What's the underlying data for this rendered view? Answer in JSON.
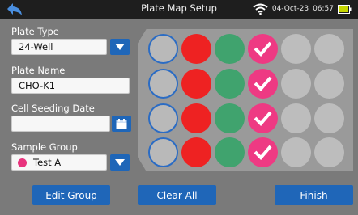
{
  "header": {
    "title": "Plate Map Setup",
    "date": "04-Oct-23",
    "time": "06:57",
    "icons": [
      "back-arrow-icon",
      "wifi-icon",
      "battery-icon"
    ]
  },
  "form": {
    "plate_type": {
      "label": "Plate Type",
      "value": "24-Well"
    },
    "plate_name": {
      "label": "Plate Name",
      "value": "CHO-K1"
    },
    "seeding_date": {
      "label": "Cell Seeding Date",
      "value": ""
    },
    "sample_group": {
      "label": "Sample Group",
      "value": "Test A",
      "color": "#e8337d"
    }
  },
  "plate": {
    "rows": 4,
    "cols": 6,
    "row_states": [
      "empty",
      "red",
      "green",
      "pink-selected",
      "grey",
      "grey"
    ]
  },
  "buttons": {
    "edit_group": "Edit Group",
    "clear_all": "Clear All",
    "finish": "Finish"
  },
  "colors": {
    "accent": "#1f66b8",
    "background": "#7a7a7a"
  }
}
